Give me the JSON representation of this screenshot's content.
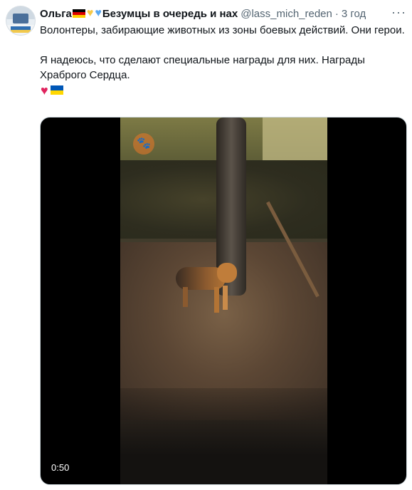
{
  "tweet": {
    "author_name": "Ольга",
    "author_suffix": "Безумцы в очередь и нах",
    "handle": "@lass_mich_reden",
    "separator": "·",
    "time": "3 год",
    "more": "···",
    "text_line1": "Волонтеры, забирающие животных из зоны боевых действий.  Они герои.",
    "text_line2": "Я надеюсь, что сделают специальные награды для них. Награды Храброго Сердца."
  },
  "media": {
    "duration": "0:50"
  },
  "icons": {
    "heart_yellow": "yellow-heart-icon",
    "heart_blue": "blue-heart-icon",
    "heart_red": "red-heart-icon",
    "paw": "paw-icon"
  },
  "colors": {
    "heart_yellow": "#f7c948",
    "heart_blue": "#5aa8f0",
    "heart_red": "#e0245e",
    "flag_ua_top": "#0057b7",
    "flag_ua_bottom": "#ffd700",
    "text_secondary": "#536471"
  }
}
